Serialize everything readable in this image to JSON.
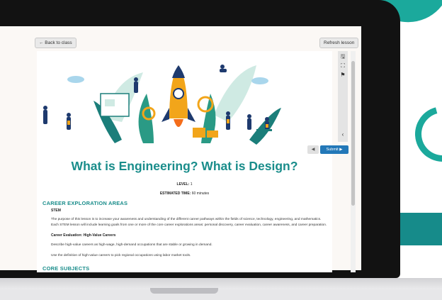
{
  "toolbar": {
    "back_label": "← Back to class",
    "refresh_label": "Refresh lesson"
  },
  "lesson": {
    "title": "What is Engineering? What is Design?",
    "level_label": "LEVEL:",
    "level_value": "1",
    "time_label": "ESTIMATED TIME:",
    "time_value": "60 minutes",
    "sections": [
      {
        "heading": "CAREER EXPLORATION AREAS",
        "subheading": "STEM",
        "paragraph": "The purpose of this lesson is to increase your awareness and understanding of the different career pathways within the fields of science, technology, engineering, and mathematics. Each STEM lesson will include learning goals from one or more of the core career explorations areas: personal discovery, career evaluation, career awareness, and career preparation.",
        "item_heading": "Career Evaluation: High-Value Careers",
        "item_p1": "Describe high-value careers as high-wage, high-demand occupations that are stable or growing in demand.",
        "item_p2": "Use the definition of high-value careers to pick regional occupations using labor market tools."
      },
      {
        "heading": "CORE SUBJECTS"
      }
    ]
  },
  "side_tools": {
    "icons": [
      "save-icon",
      "fullscreen-icon",
      "flag-icon",
      "collapse-icon"
    ],
    "glyphs": [
      "🖫",
      "⛶",
      "⚑",
      "‹"
    ]
  },
  "nav": {
    "prev_glyph": "◀",
    "submit_label": "Submit ▶"
  },
  "colors": {
    "accent": "#1a8d8b",
    "submit": "#2378b8",
    "brand_teal": "#1ba99c"
  }
}
